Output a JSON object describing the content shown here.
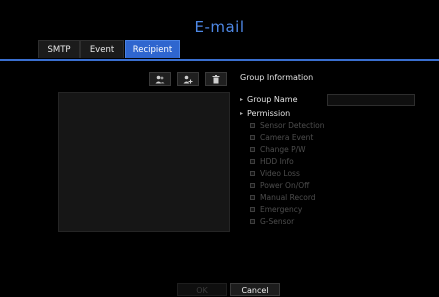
{
  "window": {
    "title": "E-mail"
  },
  "tabs": [
    {
      "label": "SMTP"
    },
    {
      "label": "Event"
    },
    {
      "label": "Recipient"
    }
  ],
  "active_tab": "Recipient",
  "toolbar": {
    "buttons": [
      {
        "icon": "group-users-icon"
      },
      {
        "icon": "add-user-icon"
      },
      {
        "icon": "trash-icon"
      }
    ]
  },
  "group_info": {
    "header": "Group Information",
    "group_name_label": "Group Name",
    "group_name_value": "",
    "permission_label": "Permission",
    "permissions": [
      "Sensor Detection",
      "Camera Event",
      "Change P/W",
      "HDD Info",
      "Video Loss",
      "Power On/Off",
      "Manual Record",
      "Emergency",
      "G-Sensor"
    ]
  },
  "footer": {
    "ok_label": "OK",
    "cancel_label": "Cancel"
  },
  "colors": {
    "accent": "#2f66cf",
    "title": "#4e88e6",
    "background": "#000000"
  }
}
